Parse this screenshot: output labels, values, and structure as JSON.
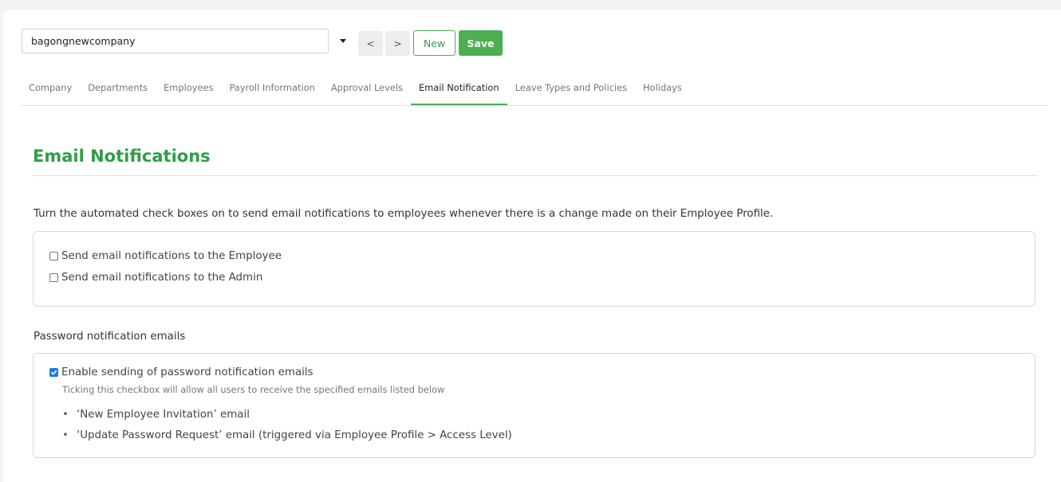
{
  "toolbar": {
    "company_value": "bagongnewcompany",
    "prev_label": "<",
    "next_label": ">",
    "new_label": "New",
    "save_label": "Save"
  },
  "tabs": [
    {
      "label": "Company"
    },
    {
      "label": "Departments"
    },
    {
      "label": "Employees"
    },
    {
      "label": "Payroll Information"
    },
    {
      "label": "Approval Levels"
    },
    {
      "label": "Email Notification",
      "active": true
    },
    {
      "label": "Leave Types and Policies"
    },
    {
      "label": "Holidays"
    }
  ],
  "section": {
    "title": "Email Notifications",
    "intro": "Turn the automated check boxes on to send email notifications to employees whenever there is a change made on their Employee Profile."
  },
  "profile_notifications": {
    "employee_label": "Send email notifications to the Employee",
    "employee_checked": false,
    "admin_label": "Send email notifications to the Admin",
    "admin_checked": false
  },
  "password_notifications": {
    "heading": "Password notification emails",
    "enable_label": "Enable sending of password notification emails",
    "enable_checked": true,
    "hint": "Ticking this checkbox will allow all users to receive the specified emails listed below",
    "bullet_glyph": "•",
    "emails": [
      "‘New Employee Invitation’ email",
      "‘Update Password Request’ email (triggered via Employee Profile > Access Level)"
    ]
  },
  "colors": {
    "accent_green": "#4caf50",
    "title_green": "#2f9e46",
    "checkbox_blue": "#1e7ae0"
  }
}
